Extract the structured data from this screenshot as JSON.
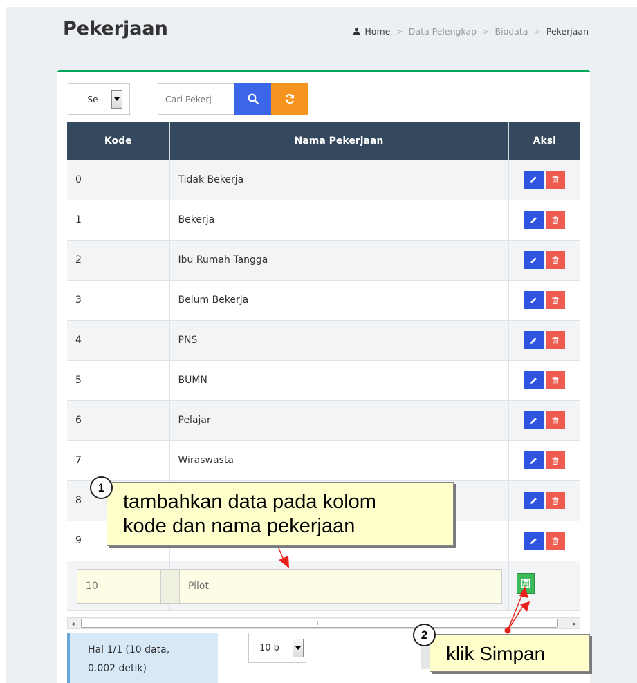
{
  "header": {
    "title": "Pekerjaan",
    "breadcrumb": [
      "Home",
      "Data Pelengkap",
      "Biodata",
      "Pekerjaan"
    ],
    "breadcrumb_sep": ">"
  },
  "toolbar": {
    "filter_select_value": "-- Se",
    "search_placeholder": "Cari Pekerj"
  },
  "table": {
    "headers": [
      "Kode",
      "Nama Pekerjaan",
      "Aksi"
    ],
    "rows": [
      {
        "kode": "0",
        "nama": "Tidak Bekerja"
      },
      {
        "kode": "1",
        "nama": "Bekerja"
      },
      {
        "kode": "2",
        "nama": "Ibu Rumah Tangga"
      },
      {
        "kode": "3",
        "nama": "Belum Bekerja"
      },
      {
        "kode": "4",
        "nama": "PNS"
      },
      {
        "kode": "5",
        "nama": "BUMN"
      },
      {
        "kode": "6",
        "nama": "Pelajar"
      },
      {
        "kode": "7",
        "nama": "Wiraswasta"
      },
      {
        "kode": "8",
        "nama": ""
      },
      {
        "kode": "9",
        "nama": ""
      }
    ]
  },
  "add_row": {
    "kode_placeholder": "10",
    "nama_placeholder": "Pilot"
  },
  "scrollbar": {
    "left_arrow": "◂",
    "right_arrow": "▸",
    "grip": "III"
  },
  "footer": {
    "info_line1": "Hal 1/1 (10 data,",
    "info_line2": "0.002 detik)",
    "per_page_value": "10 b"
  },
  "callouts": {
    "step1_number": "1",
    "step1_line1": "tambahkan data pada kolom",
    "step1_line2": "kode dan nama pekerjaan",
    "step2_number": "2",
    "step2_text": "klik Simpan"
  },
  "colors": {
    "header_bg": "#34495e",
    "edit_button": "#2f55e0",
    "delete_button": "#ef5b4f",
    "save_button": "#3dbb5b",
    "search_button": "#3c66e8",
    "refresh_button": "#f5941e",
    "box_border": "#00a65a",
    "callout_bg": "#ffffcc",
    "arrow": "#e8201a"
  },
  "icons": {
    "breadcrumb": "user-icon",
    "search": "search-icon",
    "refresh": "refresh-icon",
    "edit": "pencil-icon",
    "delete": "trash-icon",
    "save": "floppy-disk-icon"
  }
}
